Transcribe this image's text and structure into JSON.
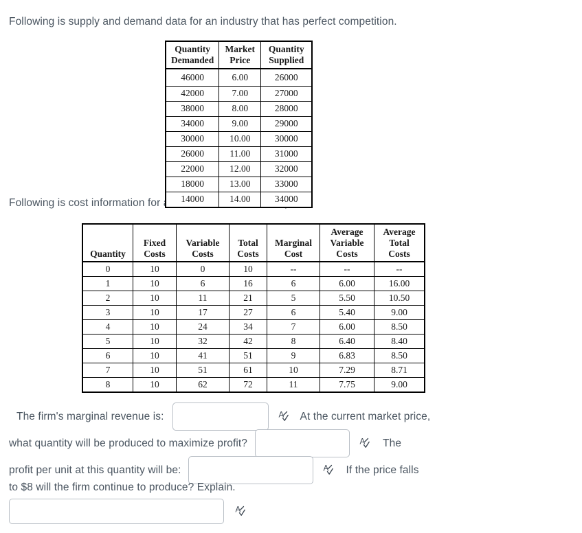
{
  "intro": {
    "line1": "Following is supply and demand data for an industry that has perfect competition.",
    "line2": "Following is cost information for a firm in the same industry."
  },
  "supply_demand_table": {
    "headers": [
      {
        "line1": "Quantity",
        "line2": "Demanded"
      },
      {
        "line1": "Market",
        "line2": "Price"
      },
      {
        "line1": "Quantity",
        "line2": "Supplied"
      }
    ],
    "rows": [
      [
        "46000",
        "6.00",
        "26000"
      ],
      [
        "42000",
        "7.00",
        "27000"
      ],
      [
        "38000",
        "8.00",
        "28000"
      ],
      [
        "34000",
        "9.00",
        "29000"
      ],
      [
        "30000",
        "10.00",
        "30000"
      ],
      [
        "26000",
        "11.00",
        "31000"
      ],
      [
        "22000",
        "12.00",
        "32000"
      ],
      [
        "18000",
        "13.00",
        "33000"
      ],
      [
        "14000",
        "14.00",
        "34000"
      ]
    ]
  },
  "cost_table": {
    "headers": [
      {
        "line1": "",
        "line2": "",
        "line3": "Quantity"
      },
      {
        "line1": "",
        "line2": "Fixed",
        "line3": "Costs"
      },
      {
        "line1": "",
        "line2": "Variable",
        "line3": "Costs"
      },
      {
        "line1": "",
        "line2": "Total",
        "line3": "Costs"
      },
      {
        "line1": "",
        "line2": "Marginal",
        "line3": "Cost"
      },
      {
        "line1": "Average",
        "line2": "Variable",
        "line3": "Costs"
      },
      {
        "line1": "Average",
        "line2": "Total",
        "line3": "Costs"
      }
    ],
    "rows": [
      [
        "0",
        "10",
        "0",
        "10",
        "--",
        "--",
        "--"
      ],
      [
        "1",
        "10",
        "6",
        "16",
        "6",
        "6.00",
        "16.00"
      ],
      [
        "2",
        "10",
        "11",
        "21",
        "5",
        "5.50",
        "10.50"
      ],
      [
        "3",
        "10",
        "17",
        "27",
        "6",
        "5.40",
        "9.00"
      ],
      [
        "4",
        "10",
        "24",
        "34",
        "7",
        "6.00",
        "8.50"
      ],
      [
        "5",
        "10",
        "32",
        "42",
        "8",
        "6.40",
        "8.40"
      ],
      [
        "6",
        "10",
        "41",
        "51",
        "9",
        "6.83",
        "8.50"
      ],
      [
        "7",
        "10",
        "51",
        "61",
        "10",
        "7.29",
        "8.71"
      ],
      [
        "8",
        "10",
        "62",
        "72",
        "11",
        "7.75",
        "9.00"
      ]
    ]
  },
  "questions": {
    "q1_prompt": "The firm's marginal revenue is:",
    "q1_value": "",
    "q1_trailing": "At the current market price,",
    "q2_prompt": "what quantity will be produced to maximize profit?",
    "q2_value": "",
    "q2_trailing": "The",
    "q3_prompt": "profit per unit at this quantity will be:",
    "q3_value": "",
    "q3_trailing": "If the price falls",
    "q4_prompt": "to $8 will the firm continue to produce?  Explain.",
    "q5_value": ""
  },
  "icons": {
    "spellcheck": "spellcheck-icon"
  },
  "colors": {
    "body_text": "#4a5560",
    "table_text": "#1a1a1a",
    "table_border": "#000000",
    "input_border": "#b9bfc6",
    "background": "#ffffff"
  }
}
